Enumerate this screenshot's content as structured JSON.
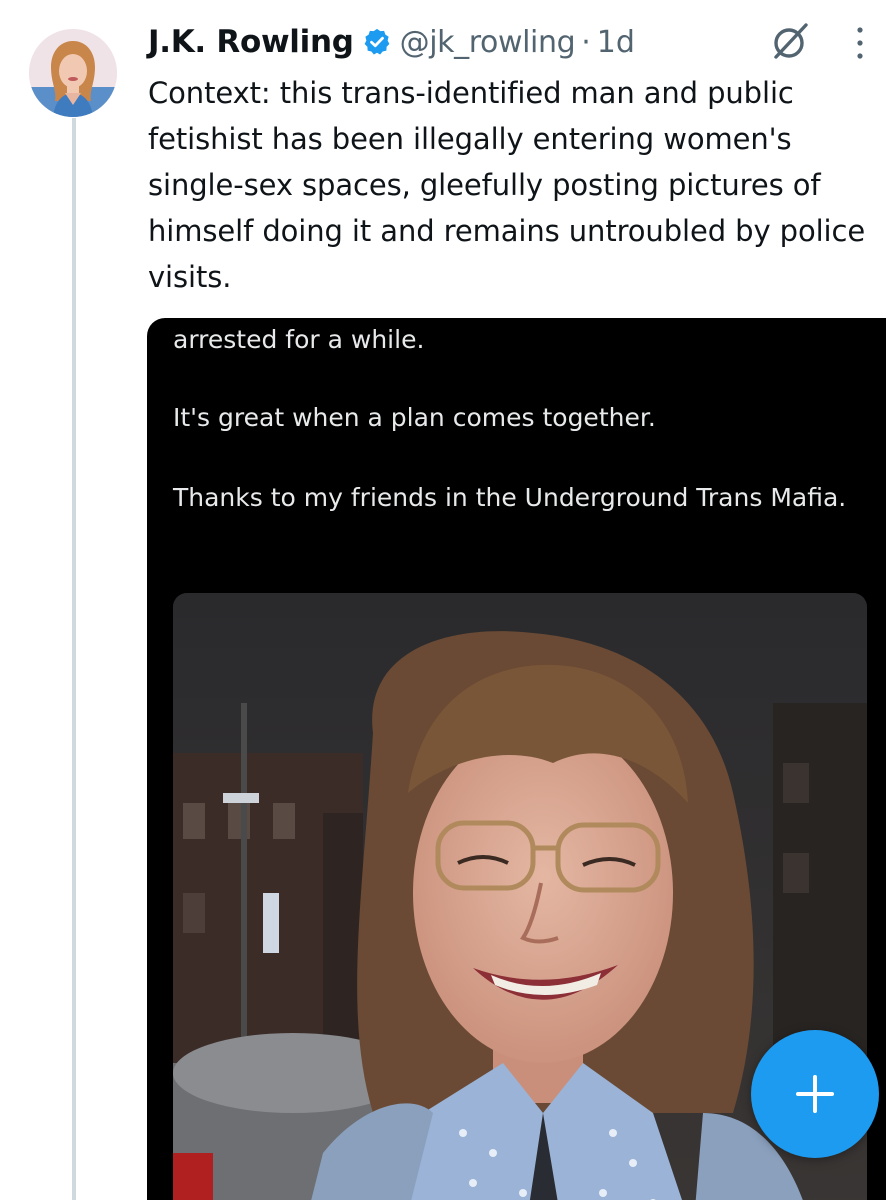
{
  "post": {
    "author_name": "J.K. Rowling",
    "author_handle": "@jk_rowling",
    "separator": "·",
    "timestamp": "1d",
    "verified": true,
    "text": "Context: this trans-identified man and public fetishist has been illegally entering women's single-sex spaces, gleefully posting pictures of himself doing it and remains untroubled by police visits."
  },
  "quoted_screenshot": {
    "line_1": "arrested for a while.",
    "line_2": "It's great when a plan comes together.",
    "line_3": "Thanks to my friends in the Underground Trans Mafia."
  },
  "icons": {
    "verified": "verified-badge-icon",
    "grok": "grok-icon",
    "more": "more-vertical-icon",
    "compose": "plus-icon"
  },
  "colors": {
    "accent": "#1d9bf0",
    "text": "#0f1419",
    "muted": "#536471",
    "thread_line": "#cfd9de"
  }
}
